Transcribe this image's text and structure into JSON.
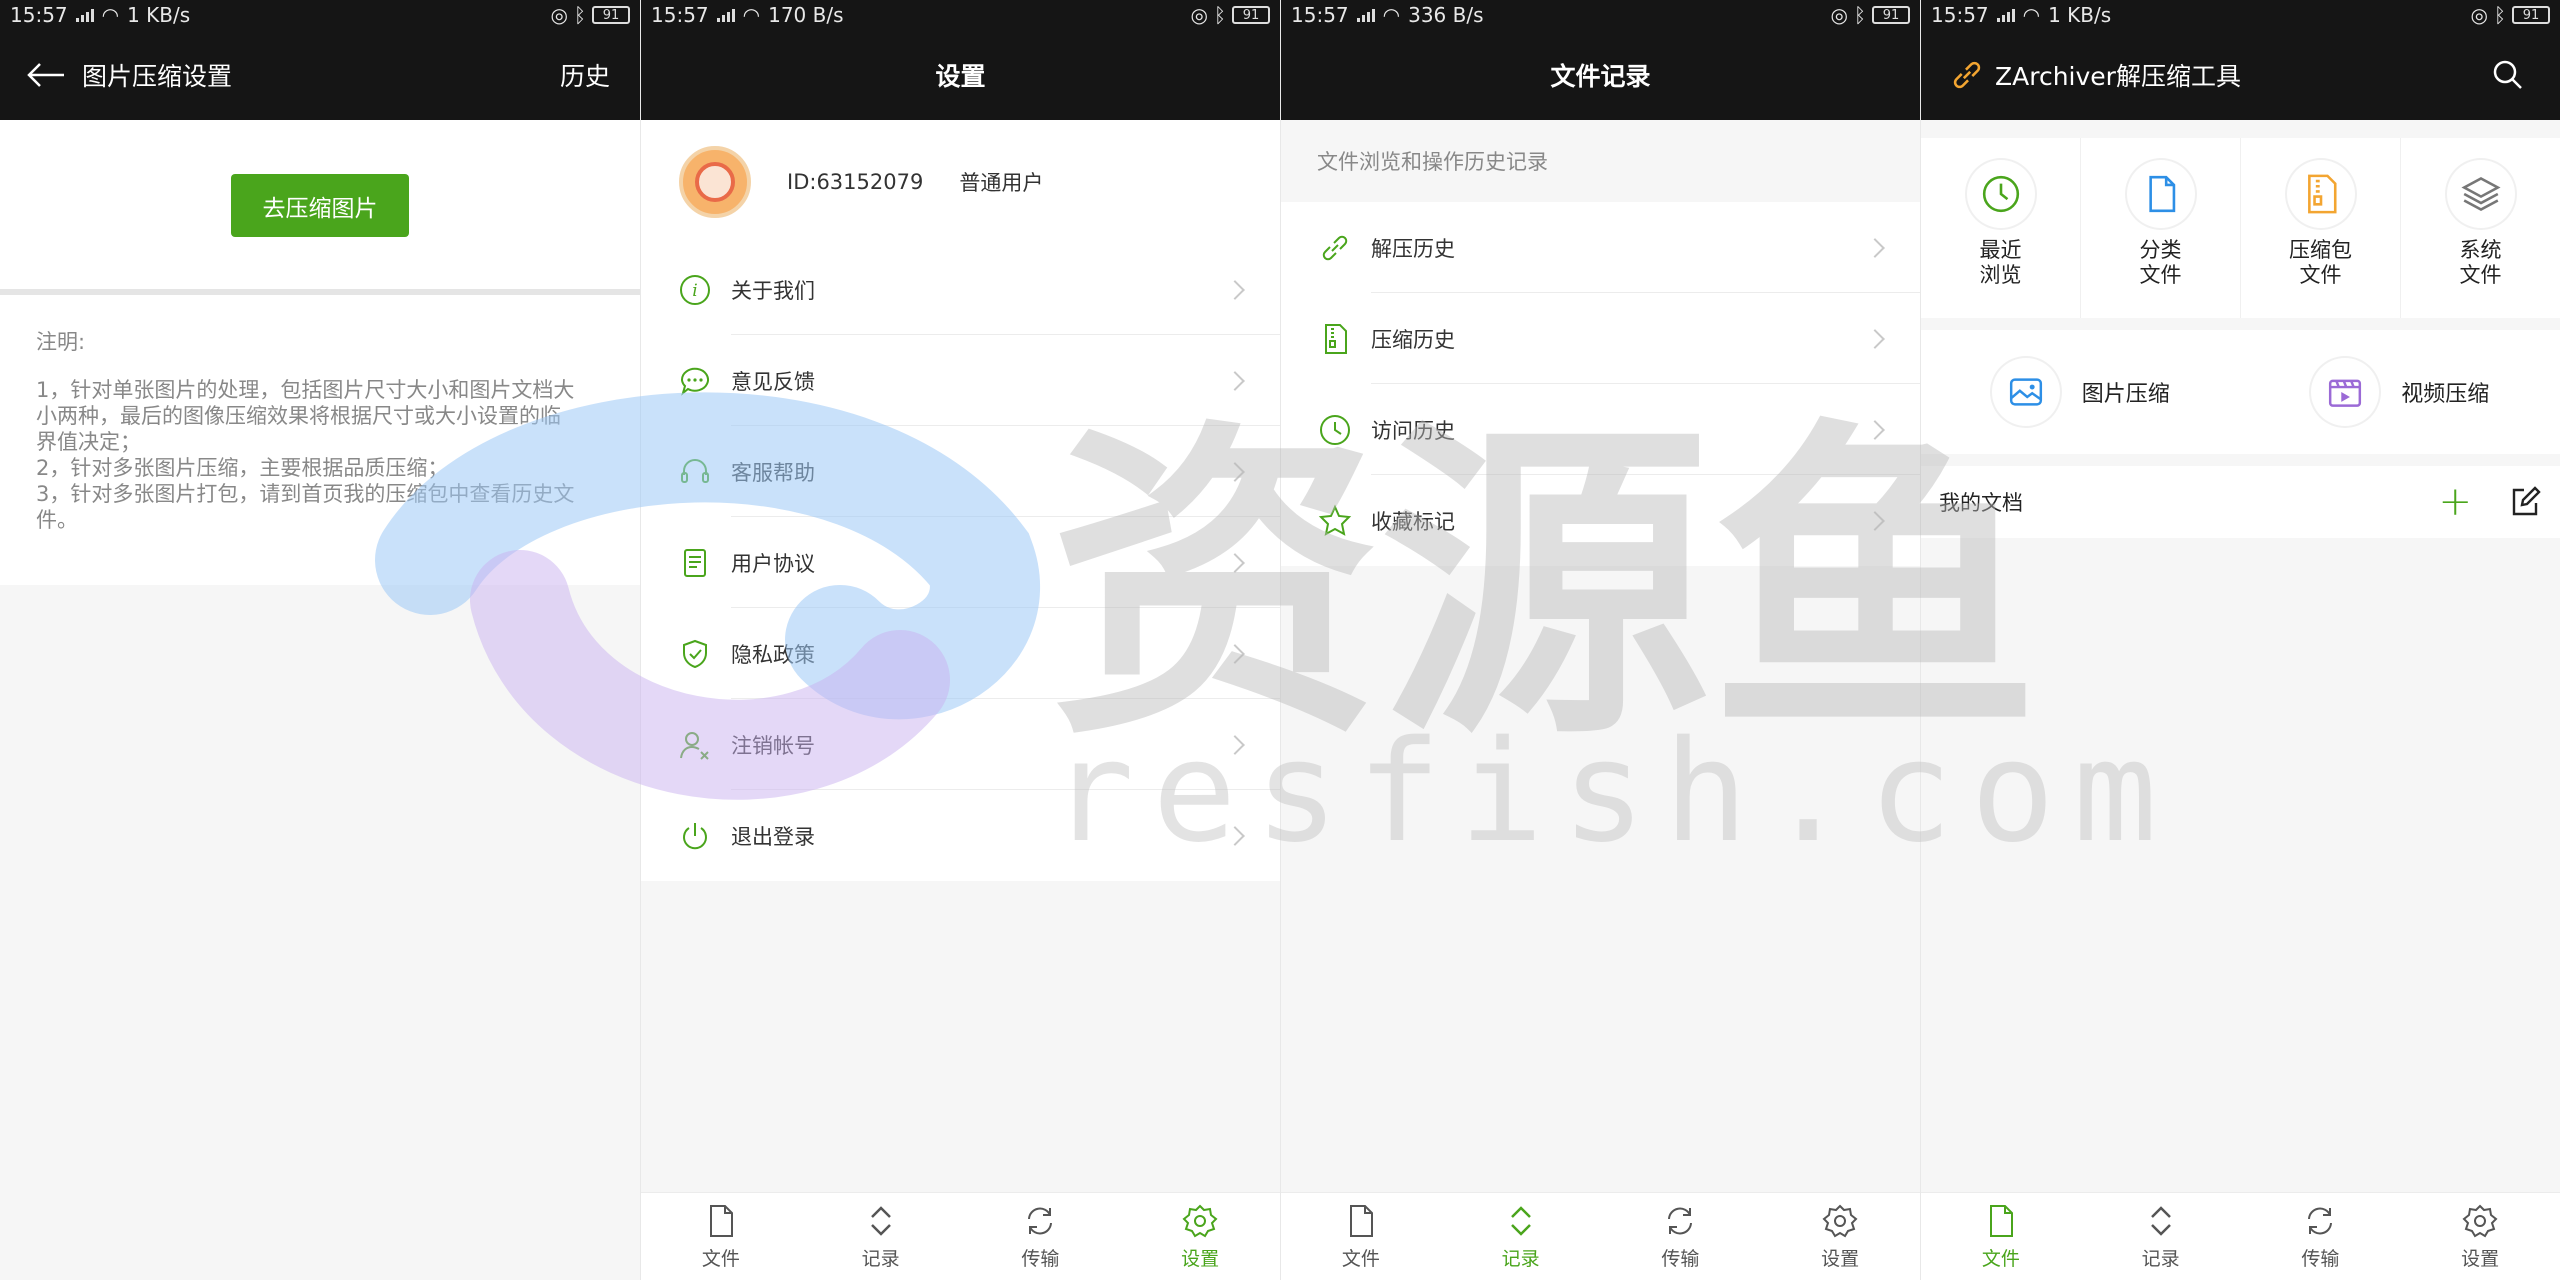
{
  "colors": {
    "accent": "#4aa51c",
    "header_bg": "#151515",
    "page_bg": "#f6f6f6"
  },
  "panels": [
    {
      "status": {
        "time": "15:57",
        "speed": "1 KB/s",
        "battery": "91"
      },
      "header": {
        "back_icon": "arrow-left-icon",
        "title": "图片压缩设置",
        "action": "历史"
      },
      "compress_button": "去压缩图片",
      "notes": {
        "title": "注明:",
        "lines": [
          "1，针对单张图片的处理，包括图片尺寸大小和图片文档大",
          "小两种，最后的图像压缩效果将根据尺寸或大小设置的临",
          "界值决定；",
          "2，针对多张图片压缩，主要根据品质压缩；",
          "3，针对多张图片打包，请到首页我的压缩包中查看历史文",
          "件。"
        ]
      }
    },
    {
      "status": {
        "time": "15:57",
        "speed": "170 B/s",
        "battery": "91"
      },
      "header": {
        "title": "设置"
      },
      "profile": {
        "id": "ID:63152079",
        "level": "普通用户"
      },
      "items": [
        {
          "label": "关于我们",
          "icon": "info-icon"
        },
        {
          "label": "意见反馈",
          "icon": "chat-icon"
        },
        {
          "label": "客服帮助",
          "icon": "headset-icon"
        },
        {
          "label": "用户协议",
          "icon": "document-icon"
        },
        {
          "label": "隐私政策",
          "icon": "shield-check-icon"
        },
        {
          "label": "注销帐号",
          "icon": "user-remove-icon"
        },
        {
          "label": "退出登录",
          "icon": "power-icon"
        }
      ],
      "nav_active": 3
    },
    {
      "status": {
        "time": "15:57",
        "speed": "336 B/s",
        "battery": "91"
      },
      "header": {
        "title": "文件记录"
      },
      "subtitle": "文件浏览和操作历史记录",
      "items": [
        {
          "label": "解压历史",
          "icon": "link-icon"
        },
        {
          "label": "压缩历史",
          "icon": "archive-file-icon"
        },
        {
          "label": "访问历史",
          "icon": "clock-icon"
        },
        {
          "label": "收藏标记",
          "icon": "star-icon"
        }
      ],
      "nav_active": 1
    },
    {
      "status": {
        "time": "15:57",
        "speed": "1 KB/s",
        "battery": "91"
      },
      "header": {
        "logo_icon": "link-icon",
        "title": "ZArchiver解压缩工具",
        "search_icon": "search-icon"
      },
      "grid": [
        {
          "line1": "最近",
          "line2": "浏览",
          "icon": "clock-icon"
        },
        {
          "line1": "分类",
          "line2": "文件",
          "icon": "file-icon"
        },
        {
          "line1": "压缩包",
          "line2": "文件",
          "icon": "zip-icon"
        },
        {
          "line1": "系统",
          "line2": "文件",
          "icon": "layers-icon"
        }
      ],
      "tools": [
        {
          "label": "图片压缩",
          "icon": "image-icon"
        },
        {
          "label": "视频压缩",
          "icon": "video-icon"
        }
      ],
      "docs_title": "我的文档",
      "nav_active": 0
    }
  ],
  "nav": [
    "文件",
    "记录",
    "传输",
    "设置"
  ],
  "watermark": {
    "cn": "资源鱼",
    "en": "resfish.com"
  }
}
